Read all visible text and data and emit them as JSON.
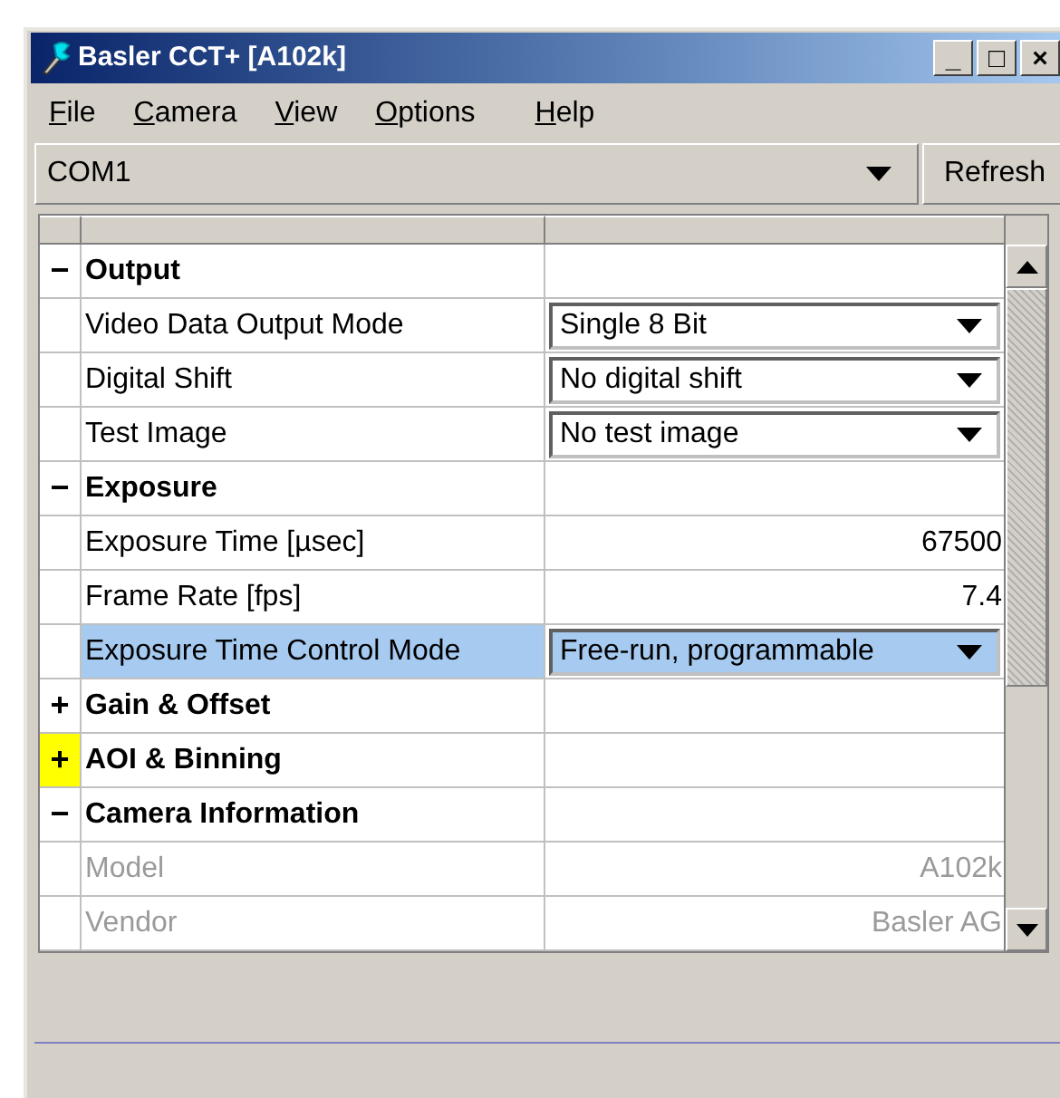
{
  "window": {
    "title": "Basler CCT+ [A102k]",
    "controls": [
      "_",
      "□",
      "×"
    ]
  },
  "menu": [
    "File",
    "Camera",
    "View",
    "Options",
    "Help"
  ],
  "port": {
    "value": "COM1",
    "button": "Refresh"
  },
  "table": {
    "rows": [
      {
        "kind": "group",
        "toggle": "−",
        "label": "Output",
        "focused": false
      },
      {
        "kind": "combo",
        "label": "Video Data Output Mode",
        "value": "Single 8 Bit",
        "selected": false,
        "disabled": false
      },
      {
        "kind": "combo",
        "label": "Digital Shift",
        "value": "No digital shift",
        "selected": false,
        "disabled": false
      },
      {
        "kind": "combo",
        "label": "Test Image",
        "value": "No test image",
        "selected": false,
        "disabled": false
      },
      {
        "kind": "group",
        "toggle": "−",
        "label": "Exposure",
        "focused": false
      },
      {
        "kind": "number",
        "label": "Exposure Time [µsec]",
        "value": "67500",
        "selected": false,
        "disabled": false
      },
      {
        "kind": "number",
        "label": "Frame Rate [fps]",
        "value": "7.4",
        "selected": false,
        "disabled": false
      },
      {
        "kind": "combo",
        "label": "Exposure Time Control Mode",
        "value": "Free-run, programmable",
        "selected": true,
        "disabled": false
      },
      {
        "kind": "group",
        "toggle": "+",
        "label": "Gain & Offset",
        "focused": false
      },
      {
        "kind": "group",
        "toggle": "+",
        "label": "AOI & Binning",
        "focused": true
      },
      {
        "kind": "group",
        "toggle": "−",
        "label": "Camera Information",
        "focused": false
      },
      {
        "kind": "number",
        "label": "Model",
        "value": "A102k",
        "selected": false,
        "disabled": true
      },
      {
        "kind": "number",
        "label": "Vendor",
        "value": "Basler AG",
        "selected": false,
        "disabled": true
      }
    ]
  }
}
